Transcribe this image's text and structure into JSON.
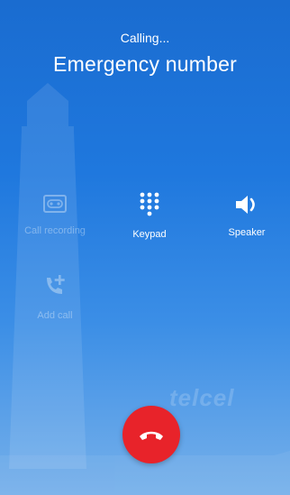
{
  "call": {
    "status": "Calling...",
    "number": "Emergency number"
  },
  "actions": [
    {
      "label": "Call recording",
      "icon": "cassette-icon",
      "enabled": false
    },
    {
      "label": "Keypad",
      "icon": "dialpad-icon",
      "enabled": true
    },
    {
      "label": "Speaker",
      "icon": "speaker-icon",
      "enabled": true
    },
    {
      "label": "Add call",
      "icon": "add-call-icon",
      "enabled": false
    }
  ],
  "watermark": {
    "carrier": "telcel"
  },
  "colors": {
    "end_call": "#e8232a",
    "background_top": "#1a6cd0",
    "background_bottom": "#76b0ea"
  }
}
